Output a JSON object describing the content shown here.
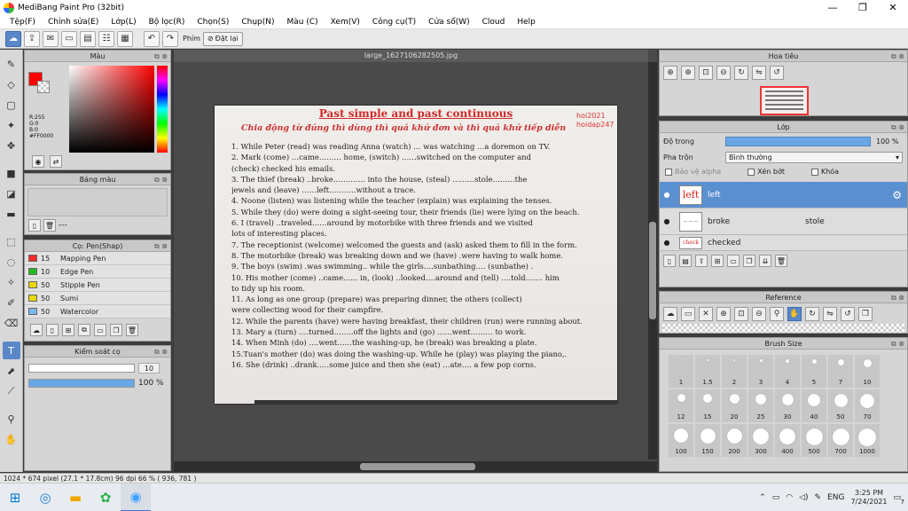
{
  "window": {
    "title": "MediBang Paint Pro (32bit)",
    "minimize": "—",
    "maximize": "❐",
    "close": "✕"
  },
  "menu": [
    "Tệp(F)",
    "Chỉnh sửa(E)",
    "Lớp(L)",
    "Bộ lọc(R)",
    "Chọn(S)",
    "Chụp(N)",
    "Màu (C)",
    "Xem(V)",
    "Công cụ(T)",
    "Cửa sổ(W)",
    "Cloud",
    "Help"
  ],
  "toolbar": {
    "phim_label": "Phím",
    "reset_label": "Đặt lại"
  },
  "color_panel": {
    "title": "Màu",
    "rgb_lines": [
      "R:255",
      "G:0",
      "B:0",
      "#FF0000"
    ],
    "fg_color": "#FF0000"
  },
  "palette_panel": {
    "title": "Bảng màu",
    "footer_text": "---"
  },
  "brush_panel": {
    "title": "Cọ: Pen(Shap)",
    "brushes": [
      {
        "size": "15",
        "name": "Mapping Pen",
        "color": "#ff2a2a"
      },
      {
        "size": "10",
        "name": "Edge Pen",
        "color": "#22bb22"
      },
      {
        "size": "50",
        "name": "Stipple Pen",
        "color": "#e8d800"
      },
      {
        "size": "50",
        "name": "Sumi",
        "color": "#e8d800"
      },
      {
        "size": "50",
        "name": "Watercolor",
        "color": "#7ab8ee"
      }
    ]
  },
  "control_panel": {
    "title": "Kiểm soát cọ",
    "size_value": "10",
    "size_fraction": 1.0,
    "opacity_value": "100 %",
    "opacity_fraction": 1.0
  },
  "canvas": {
    "tab": "large_1627106282505.jpg",
    "page_title": "Past simple and past continuous",
    "page_subtitle": "Chia động từ đúng thì dùng thì quá khứ đơn và thì quá khứ tiếp diễn",
    "watermark_1": "hoi2021",
    "watermark_2": "hoidap247",
    "lines": [
      "1. While Peter (read) was reading Anna (watch) … was watching …a doremon on TV.",
      "2. Mark (come) …came……… home, (switch) ……switched on the computer and",
      "(check) checked his emails.",
      "3. The thief (break) ..broke…………. into the house, (steal) ………stole………the",
      "jewels and (leave) ……left………..without a trace.",
      "4. Noone (listen) was listening while the teacher (explain) was explaining the tenses.",
      "5. While they (do) were doing a sight-seeing tour, their friends (lie) were lying on the beach.",
      "6. I (travel) ..traveled……around by motorbike with three friends and we visited",
      "lots of interesting places.",
      "7. The receptionist (welcome) welcomed the guests and (ask) asked them to fill in the form.",
      "8. The motorbike (break) was breaking down and we (have) .were having to walk home.",
      "9. The boys (swim) .was swimming.. while the girls….sunbathing…. (sunbathe) .",
      "10. His mother (come) ..came…... in, (look) ..looked….around and (tell) ….told……. him",
      "to tidy up his room.",
      "11. As long as one group (prepare) was preparing dinner, the others (collect)",
      "were collecting wood for their campfire.",
      "12. While the parents (have) were having breakfast, their children (run) were running about.",
      "13. Mary a (turn) ….turned……..off the lights and (go) ……went……… to work.",
      "14. When Minh (do) ….went……the washing-up, he (break) was breaking a plate.",
      "15.Tuan's mother (do) was doing the washing-up. While he (play) was playing the piano,.",
      "16. She (drink) ..drank..…some juice and then she (eat) …ate…. a few pop corns."
    ]
  },
  "navigator": {
    "title": "Hoa tiêu"
  },
  "layer_panel": {
    "title": "Lớp",
    "opacity_label": "Độ trong",
    "opacity_value": "100 %",
    "opacity_fraction": 1.0,
    "blend_label": "Pha trộn",
    "blend_value": "Bình thường",
    "protect_alpha": "Bảo vệ alpha",
    "clipping": "Xén bớt",
    "lock": "Khóa",
    "layers": [
      {
        "name": "left",
        "thumb": "left",
        "extra": ""
      },
      {
        "name": "broke",
        "thumb": "~~~",
        "extra": "stole"
      },
      {
        "name": "checked",
        "thumb": "check",
        "extra": ""
      }
    ]
  },
  "reference_panel": {
    "title": "Reference"
  },
  "brush_size_panel": {
    "title": "Brush Size",
    "sizes": [
      "1",
      "1.5",
      "2",
      "3",
      "4",
      "5",
      "7",
      "10",
      "12",
      "15",
      "20",
      "25",
      "30",
      "40",
      "50",
      "70",
      "100",
      "150",
      "200",
      "300",
      "400",
      "500",
      "700",
      "1000"
    ]
  },
  "status": {
    "text": "1024 * 674 pixel   (27.1 * 17.8cm)   96 dpi   66 %   ( 936, 781 )"
  },
  "taskbar": {
    "lang": "ENG",
    "time": "3:25 PM",
    "date": "7/24/2021",
    "notif_count": "7"
  }
}
